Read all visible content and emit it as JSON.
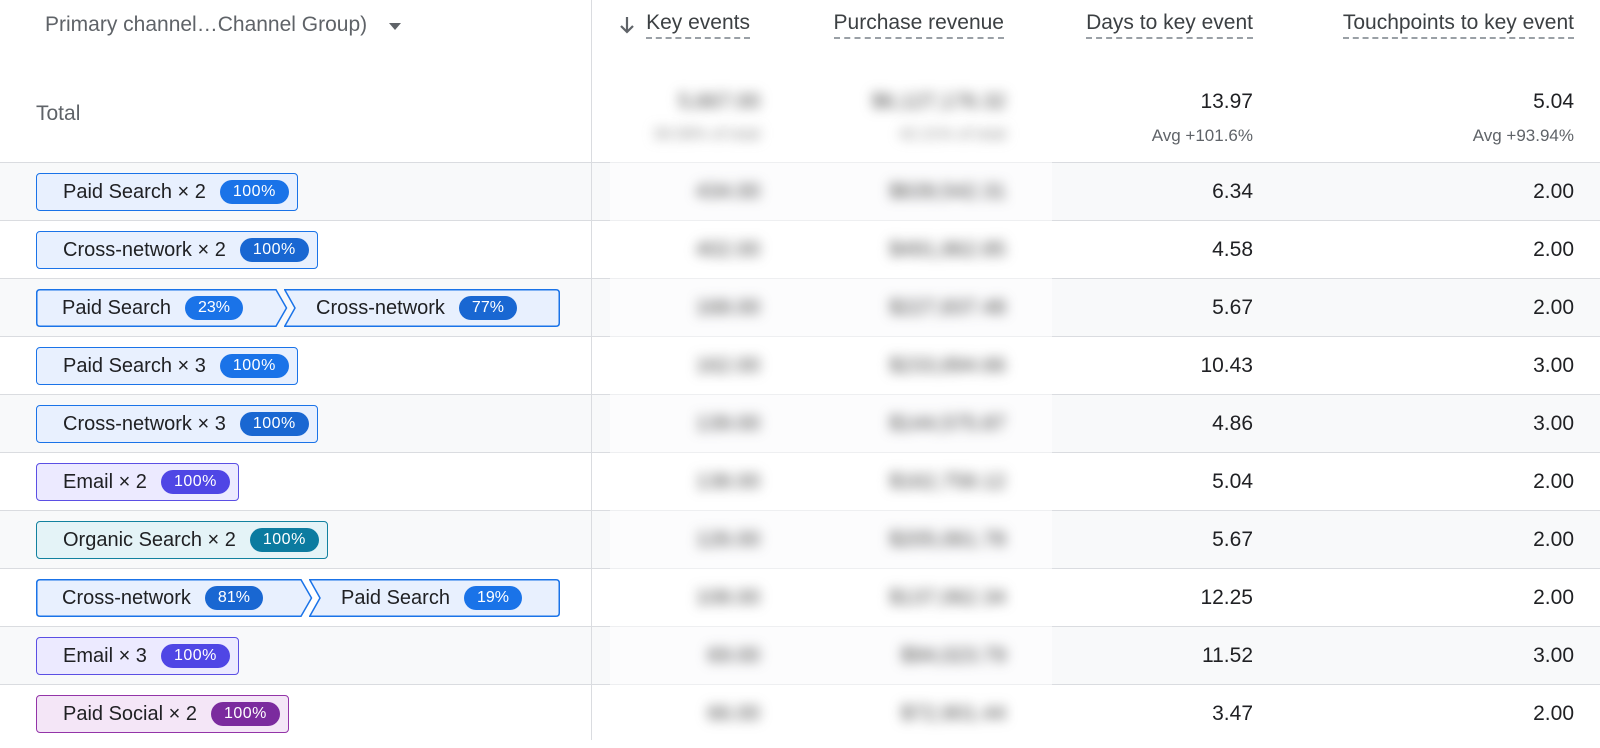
{
  "header": {
    "dimension_label": "Primary channel…Channel Group)",
    "columns": {
      "key_events": "Key events",
      "purchase_revenue": "Purchase revenue",
      "days_to_key_event": "Days to key event",
      "touchpoints": "Touchpoints to key event"
    }
  },
  "total": {
    "label": "Total",
    "key_events": "5,667.00",
    "key_events_sub": "39.58% of total",
    "purchase_revenue": "$6,127,176.32",
    "purchase_revenue_sub": "42.21% of total",
    "days_to_key_event": "13.97",
    "days_sub": "Avg +101.6%",
    "touchpoints": "5.04",
    "touch_sub": "Avg +93.94%"
  },
  "rows": [
    {
      "path": [
        {
          "label": "Paid Search × 2",
          "pct": "100%"
        }
      ],
      "key_events": "434.00",
      "revenue": "$639,542.31",
      "days": "6.34",
      "touch": "2.00"
    },
    {
      "path": [
        {
          "label": "Cross-network × 2",
          "pct": "100%"
        }
      ],
      "key_events": "402.00",
      "revenue": "$491,862.85",
      "days": "4.58",
      "touch": "2.00"
    },
    {
      "path": [
        {
          "label": "Paid Search",
          "pct": "23%"
        },
        {
          "label": "Cross-network",
          "pct": "77%"
        }
      ],
      "key_events": "168.00",
      "revenue": "$227,837.48",
      "days": "5.67",
      "touch": "2.00"
    },
    {
      "path": [
        {
          "label": "Paid Search × 3",
          "pct": "100%"
        }
      ],
      "key_events": "162.00",
      "revenue": "$233,894.66",
      "days": "10.43",
      "touch": "3.00"
    },
    {
      "path": [
        {
          "label": "Cross-network × 3",
          "pct": "100%"
        }
      ],
      "key_events": "139.00",
      "revenue": "$144,575.87",
      "days": "4.86",
      "touch": "3.00"
    },
    {
      "path": [
        {
          "label": "Email × 2",
          "pct": "100%"
        }
      ],
      "key_events": "138.00",
      "revenue": "$162,758.12",
      "days": "5.04",
      "touch": "2.00"
    },
    {
      "path": [
        {
          "label": "Organic Search × 2",
          "pct": "100%"
        }
      ],
      "key_events": "126.00",
      "revenue": "$205,061.78",
      "days": "5.67",
      "touch": "2.00"
    },
    {
      "path": [
        {
          "label": "Cross-network",
          "pct": "81%"
        },
        {
          "label": "Paid Search",
          "pct": "19%"
        }
      ],
      "key_events": "108.00",
      "revenue": "$137,062.34",
      "days": "12.25",
      "touch": "2.00"
    },
    {
      "path": [
        {
          "label": "Email × 3",
          "pct": "100%"
        }
      ],
      "key_events": "69.00",
      "revenue": "$94,023.79",
      "days": "11.52",
      "touch": "3.00"
    },
    {
      "path": [
        {
          "label": "Paid Social × 2",
          "pct": "100%"
        }
      ],
      "key_events": "66.00",
      "revenue": "$72,901.44",
      "days": "3.47",
      "touch": "2.00"
    }
  ]
}
